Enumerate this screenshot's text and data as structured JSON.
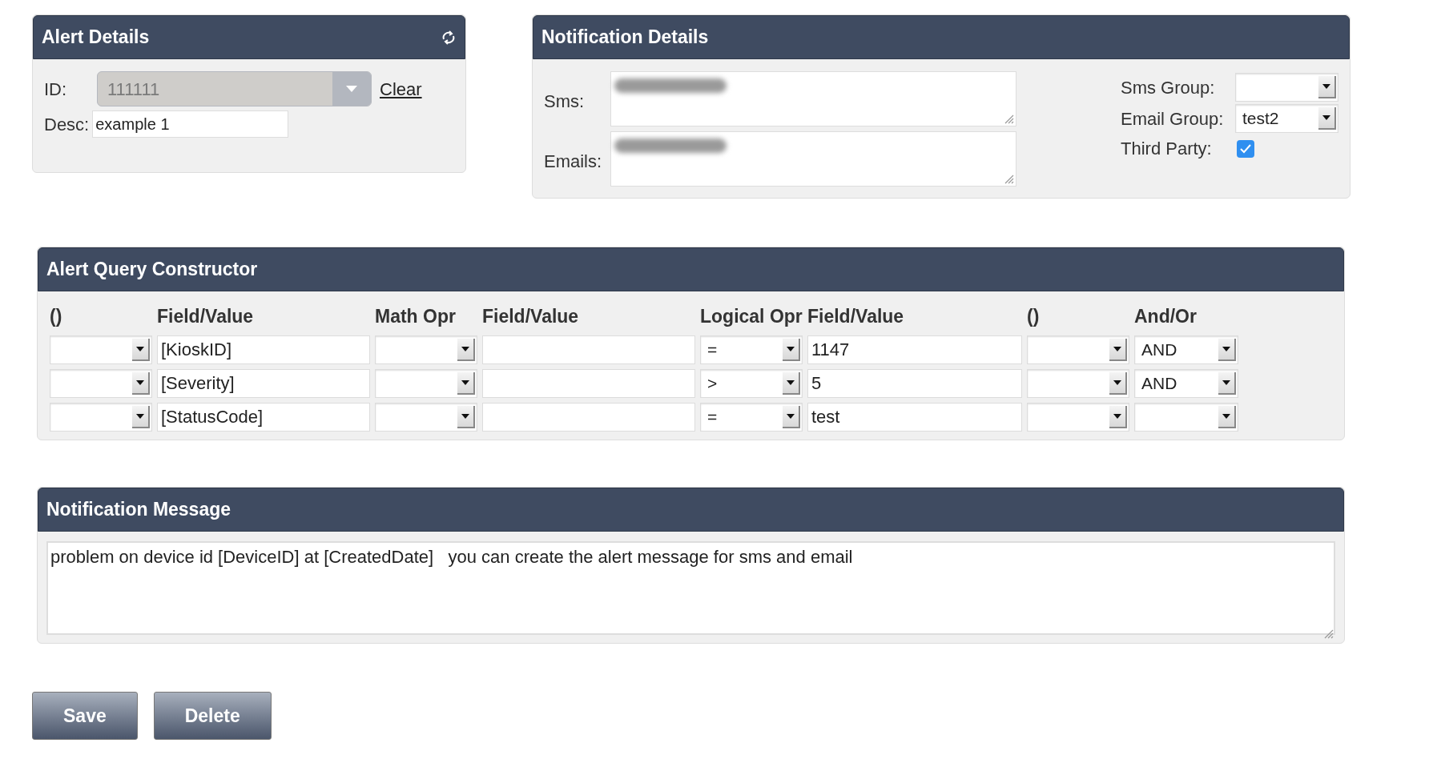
{
  "alert_details": {
    "title": "Alert Details",
    "id": {
      "label": "ID:",
      "value": "111111",
      "disabled": true
    },
    "clear_link": "Clear",
    "desc": {
      "label": "Desc:",
      "value": "example 1"
    }
  },
  "notification_details": {
    "title": "Notification Details",
    "sms": {
      "label": "Sms:",
      "redacted": true
    },
    "emails": {
      "label": "Emails:",
      "redacted": true
    },
    "sms_group": {
      "label": "Sms Group:"
    },
    "email_group": {
      "label": "Email Group:",
      "value": "test2"
    },
    "third_party": {
      "label": "Third Party:",
      "checked": true
    }
  },
  "query": {
    "title": "Alert Query Constructor",
    "columns": [
      "()",
      "Field/Value",
      "Math Opr",
      "Field/Value",
      "Logical Opr",
      "Field/Value",
      "()",
      "And/Or"
    ],
    "rows": [
      {
        "cells": [
          {
            "kind": "select"
          },
          {
            "kind": "input",
            "value": "[KioskID]"
          },
          {
            "kind": "select"
          },
          {
            "kind": "input"
          },
          {
            "kind": "select",
            "value": "="
          },
          {
            "kind": "input",
            "value": "1147"
          },
          {
            "kind": "select"
          },
          {
            "kind": "select",
            "value": "AND"
          }
        ]
      },
      {
        "cells": [
          {
            "kind": "select"
          },
          {
            "kind": "input",
            "value": "[Severity]"
          },
          {
            "kind": "select"
          },
          {
            "kind": "input"
          },
          {
            "kind": "select",
            "value": ">"
          },
          {
            "kind": "input",
            "value": "5"
          },
          {
            "kind": "select"
          },
          {
            "kind": "select",
            "value": "AND"
          }
        ]
      },
      {
        "cells": [
          {
            "kind": "select"
          },
          {
            "kind": "input",
            "value": "[StatusCode]"
          },
          {
            "kind": "select"
          },
          {
            "kind": "input"
          },
          {
            "kind": "select",
            "value": "="
          },
          {
            "kind": "input",
            "value": "test"
          },
          {
            "kind": "select"
          },
          {
            "kind": "select"
          }
        ]
      }
    ]
  },
  "message": {
    "title": "Notification Message",
    "value": "problem on device id [DeviceID] at [CreatedDate]   you can create the alert message for sms and email"
  },
  "buttons": [
    "Save",
    "Delete"
  ]
}
